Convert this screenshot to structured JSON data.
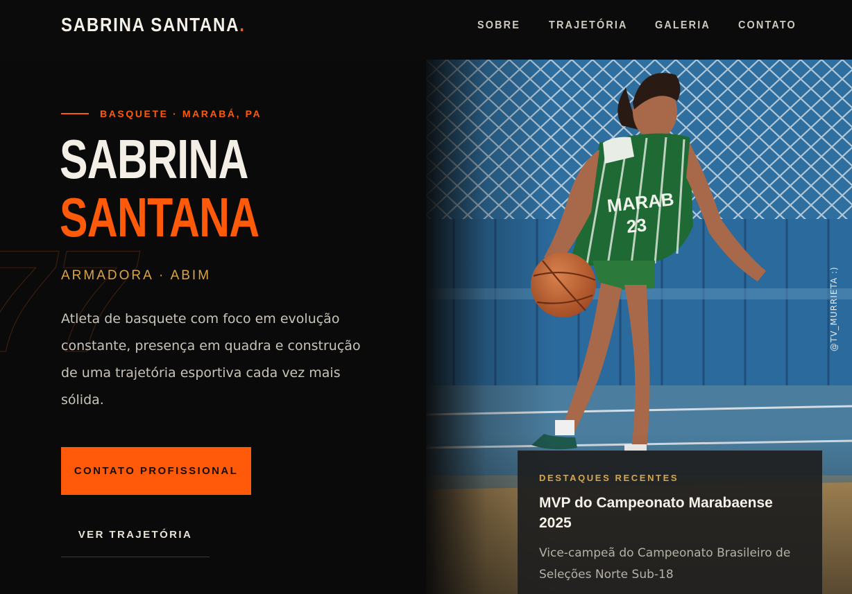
{
  "brand": {
    "name": "SABRINA SANTANA",
    "dot": "."
  },
  "nav": {
    "items": [
      "SOBRE",
      "TRAJETÓRIA",
      "GALERIA",
      "CONTATO"
    ]
  },
  "hero": {
    "eyebrow": "BASQUETE · MARABÁ, PA",
    "first_name": "SABRINA",
    "last_name": "SANTANA",
    "role": "ARMADORA · ABIM",
    "bio": "Atleta de basquete com foco em evolução constante, presença em quadra e construção de uma trajetória esportiva cada vez mais sólida.",
    "primary_cta": "CONTATO PROFISSIONAL",
    "secondary_cta": "VER TRAJETÓRIA"
  },
  "photo": {
    "credit": "@TV_MURRIETA :)"
  },
  "highlight_card": {
    "label": "DESTAQUES RECENTES",
    "title": "MVP do Campeonato Marabaense 2025",
    "description": "Vice-campeã do Campeonato Brasileiro de Seleções Norte Sub-18"
  },
  "colors": {
    "accent": "#ff5a0a",
    "gold": "#d8a64a",
    "background": "#0a0a0a"
  }
}
